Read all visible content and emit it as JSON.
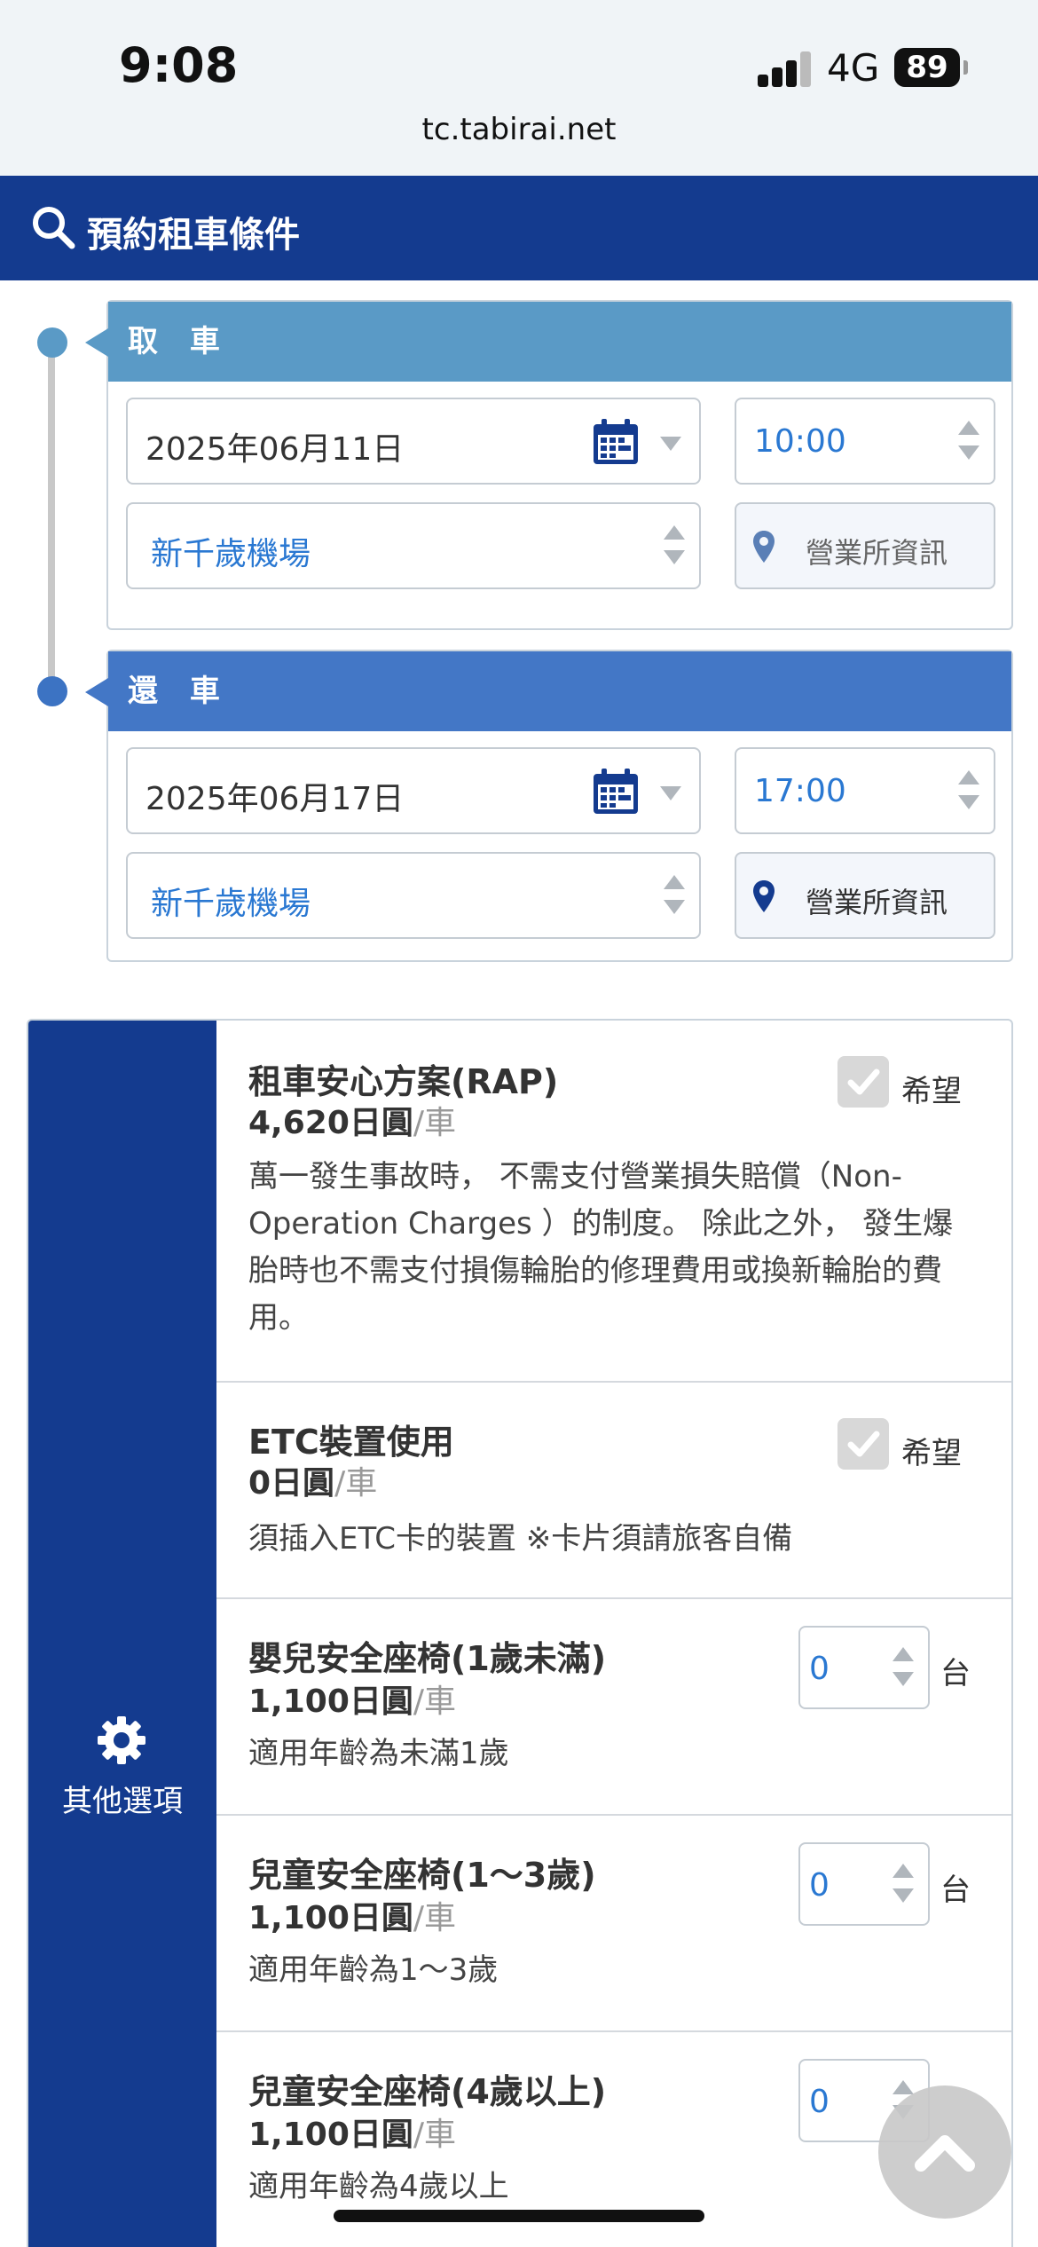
{
  "status": {
    "time": "9:08",
    "network": "4G",
    "battery": "89"
  },
  "browser": {
    "url": "tc.tabirai.net"
  },
  "header": {
    "title": "預約租車條件"
  },
  "pickup": {
    "label": "取 車",
    "date": "2025年06月11日",
    "time": "10:00",
    "location": "新千歲機場",
    "office_info": "營業所資訊"
  },
  "return": {
    "label": "還 車",
    "date": "2025年06月17日",
    "time": "17:00",
    "location": "新千歲機場",
    "office_info": "營業所資訊"
  },
  "options": {
    "section_label": "其他選項",
    "items": [
      {
        "name": "租車安心方案(RAP)",
        "price": "4,620日圓",
        "unit": "/車",
        "desc": "萬一發生事故時， 不需支付營業損失賠償（Non-Operation Charges ）的制度。 除此之外， 發生爆胎時也不需支付損傷輪胎的修理費用或換新輪胎的費用。",
        "check_label": "希望"
      },
      {
        "name": "ETC裝置使用",
        "price": "0日圓",
        "unit": "/車",
        "desc": "須插入ETC卡的裝置 ※卡片須請旅客自備",
        "check_label": "希望"
      },
      {
        "name": "嬰兒安全座椅(1歲未滿)",
        "price": "1,100日圓",
        "unit": "/車",
        "desc": "適用年齡為未滿1歲",
        "qty": "0",
        "qty_unit": "台"
      },
      {
        "name": "兒童安全座椅(1〜3歲)",
        "price": "1,100日圓",
        "unit": "/車",
        "desc": "適用年齡為1〜3歲",
        "qty": "0",
        "qty_unit": "台"
      },
      {
        "name": "兒童安全座椅(4歲以上)",
        "price": "1,100日圓",
        "unit": "/車",
        "desc": "適用年齡為4歲以上",
        "qty": "0"
      }
    ]
  },
  "colors": {
    "header": "#143b8f",
    "pickup": "#5a9ac6",
    "return": "#4377c6",
    "link": "#2a78d2"
  }
}
